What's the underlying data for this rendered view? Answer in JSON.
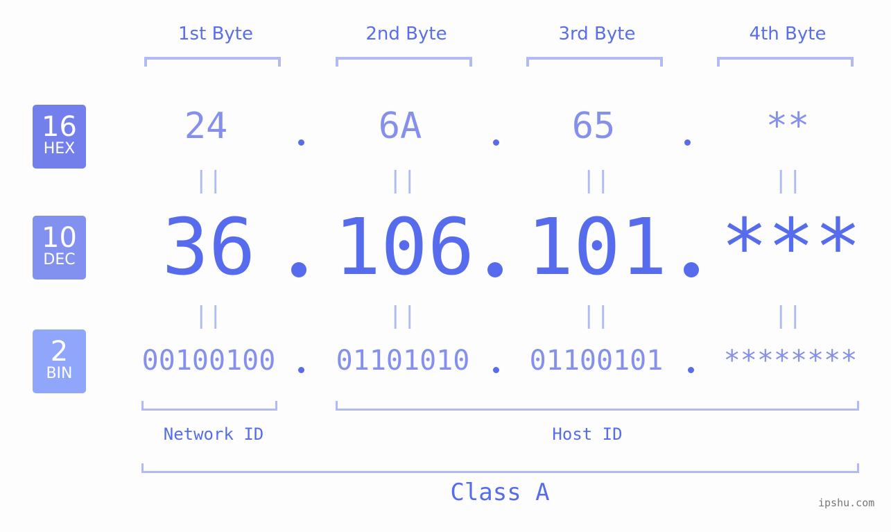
{
  "bytes_header": [
    "1st Byte",
    "2nd Byte",
    "3rd Byte",
    "4th Byte"
  ],
  "badges": [
    {
      "num": "16",
      "label": "HEX",
      "color": "#7380ec"
    },
    {
      "num": "10",
      "label": "DEC",
      "color": "#8290f0"
    },
    {
      "num": "2",
      "label": "BIN",
      "color": "#8fa6fa"
    }
  ],
  "hex": [
    "24",
    "6A",
    "65",
    "**"
  ],
  "dec": [
    "36",
    "106",
    "101",
    "***"
  ],
  "bin": [
    "00100100",
    "01101010",
    "01100101",
    "********"
  ],
  "separator": ".",
  "equals_sign": "||",
  "network_id_label": "Network ID",
  "host_id_label": "Host ID",
  "class_label": "Class A",
  "site": "ipshu.com",
  "colors": {
    "accent": "#566cec",
    "light": "#8590ed",
    "bracket": "#b2baf5"
  }
}
